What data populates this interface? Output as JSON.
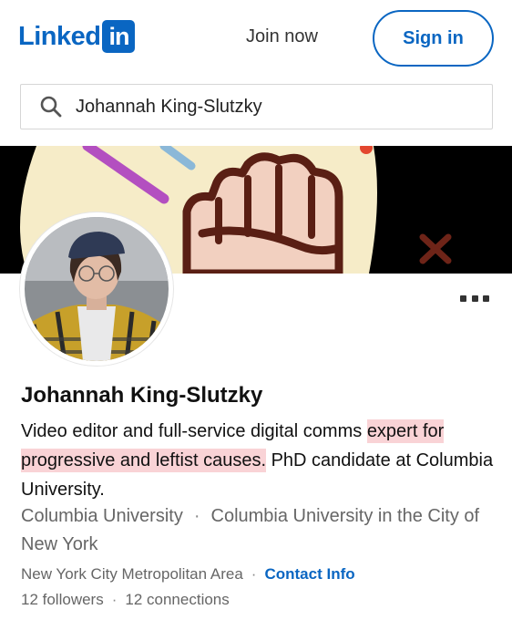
{
  "header": {
    "logo_text": "Linked",
    "logo_badge": "in",
    "join_label": "Join now",
    "signin_label": "Sign in"
  },
  "search": {
    "value": "Johannah King-Slutzky",
    "icon": "search-icon"
  },
  "profile": {
    "name": "Johannah King-Slutzky",
    "headline_part1": "Video editor and full-service digital comms ",
    "headline_highlight1": "expert for",
    "headline_highlight2": "progressive and leftist causes.",
    "headline_part2": " PhD candidate at Columbia University.",
    "education_1": "Columbia University",
    "education_separator": "·",
    "education_2": "Columbia University in the City of New York",
    "location": "New York City Metropolitan Area",
    "location_separator": "·",
    "contact_label": "Contact Info",
    "followers": "12 followers",
    "stats_separator": "·",
    "connections": "12 connections"
  },
  "colors": {
    "brand": "#0a66c2",
    "highlight": "#f9d3d6",
    "banner_bg": "#000000"
  },
  "icons": [
    "search-icon",
    "more-options-icon",
    "raised-fist-graphic"
  ]
}
